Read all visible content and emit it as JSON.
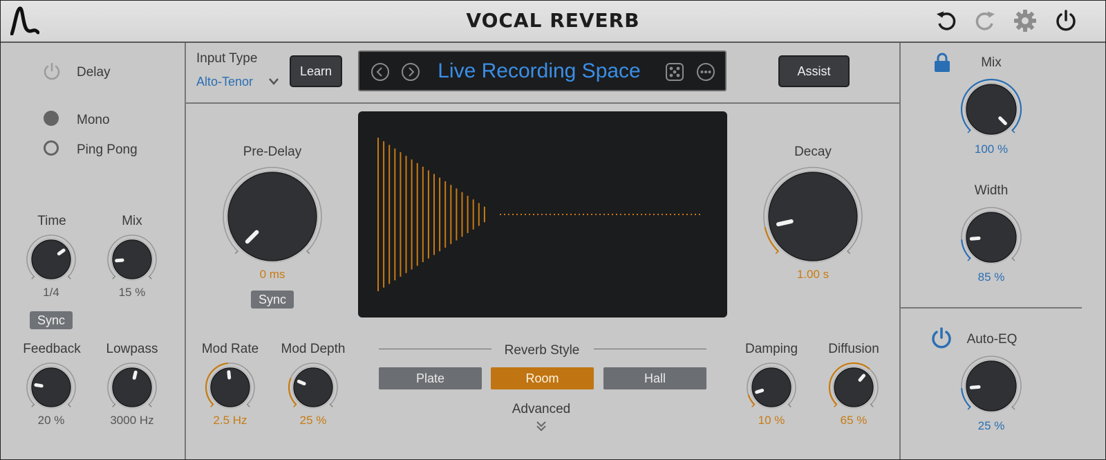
{
  "app": {
    "title": "VOCAL REVERB",
    "icons": {
      "logo": "waveform-logo-icon",
      "undo": "undo-icon",
      "redo": "redo-icon",
      "settings": "gear-icon",
      "power": "power-icon"
    }
  },
  "delay": {
    "label": "Delay",
    "enabled": false,
    "modes": [
      {
        "label": "Mono",
        "selected": true
      },
      {
        "label": "Ping Pong",
        "selected": false
      }
    ],
    "time": {
      "label": "Time",
      "value": "1/4",
      "level": 0.7
    },
    "mix": {
      "label": "Mix",
      "value": "15 %",
      "level": 0.15
    },
    "sync_label": "Sync",
    "feedback": {
      "label": "Feedback",
      "value": "20 %",
      "level": 0.2
    },
    "lowpass": {
      "label": "Lowpass",
      "value": "3000 Hz",
      "level": 0.55
    }
  },
  "input": {
    "label": "Input Type",
    "selected": "Alto-Tenor",
    "learn_label": "Learn"
  },
  "preset": {
    "name": "Live Recording Space",
    "icons": [
      "chevron-left-icon",
      "chevron-right-icon",
      "dice-icon",
      "more-icon"
    ]
  },
  "assist_label": "Assist",
  "main": {
    "predelay": {
      "label": "Pre-Delay",
      "value": "0 ms",
      "level": 0.0
    },
    "predelay_sync": "Sync",
    "decay": {
      "label": "Decay",
      "value": "1.00 s",
      "level": 0.12
    },
    "mod_rate": {
      "label": "Mod Rate",
      "value": "2.5 Hz",
      "level": 0.48
    },
    "mod_depth": {
      "label": "Mod Depth",
      "value": "25 %",
      "level": 0.25
    },
    "reverb_style": {
      "label": "Reverb Style",
      "options": [
        "Plate",
        "Room",
        "Hall"
      ],
      "selected": "Room"
    },
    "advanced_label": "Advanced",
    "damping": {
      "label": "Damping",
      "value": "10 %",
      "level": 0.1
    },
    "diffusion": {
      "label": "Diffusion",
      "value": "65 %",
      "level": 0.65
    }
  },
  "output": {
    "mix": {
      "label": "Mix",
      "value": "100 %",
      "level": 1.0
    },
    "width": {
      "label": "Width",
      "value": "85 %",
      "level": 0.15
    },
    "auto_eq": {
      "label": "Auto-EQ",
      "value": "25 %",
      "level": 0.15,
      "enabled": true
    }
  },
  "colors": {
    "accent_orange": "#c77b12",
    "accent_blue": "#2a6fb3",
    "panel": "#c8c8c8",
    "display_bg": "#1b1c1e"
  }
}
